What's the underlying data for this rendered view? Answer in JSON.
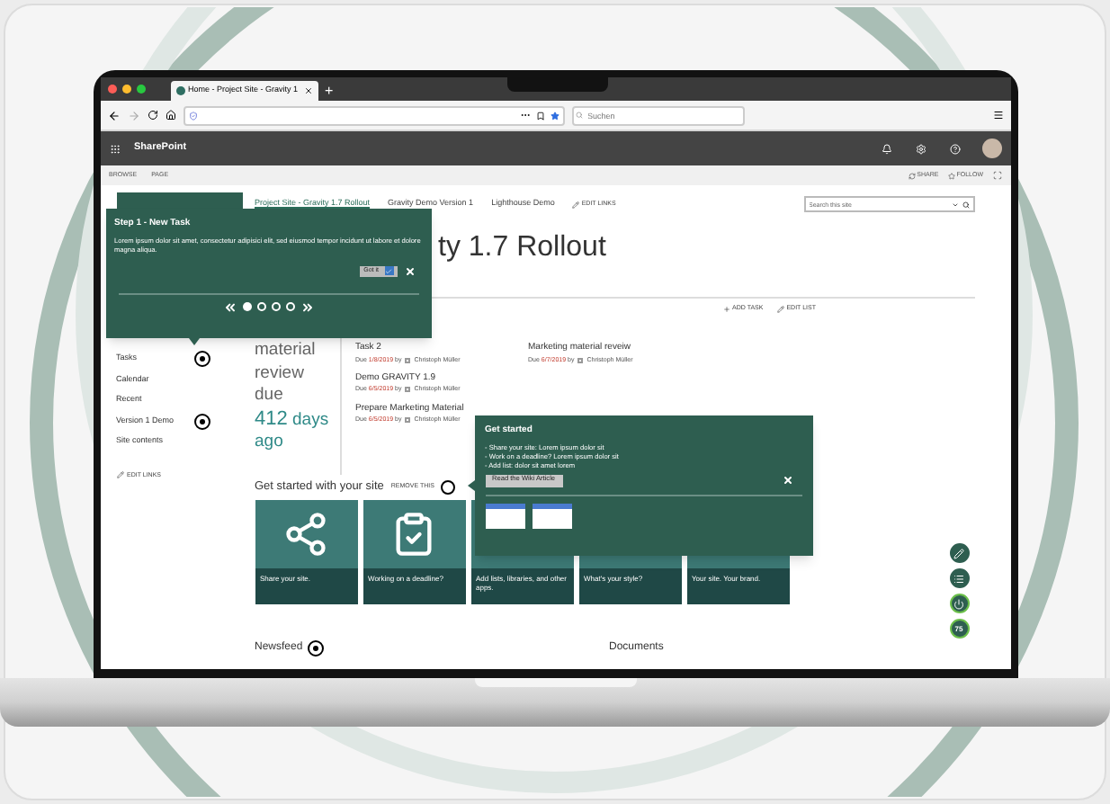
{
  "browser": {
    "tab_title": "Home - Project Site - Gravity 1",
    "new_tab": "+",
    "search_placeholder": "Suchen"
  },
  "suite_bar": {
    "app_name": "SharePoint"
  },
  "ribbon": {
    "tabs": [
      "BROWSE",
      "PAGE"
    ],
    "actions": [
      {
        "label": "SHARE",
        "kind": "share"
      },
      {
        "label": "FOLLOW",
        "kind": "follow"
      }
    ]
  },
  "top_nav": {
    "links": [
      {
        "label": "Project Site - Gravity 1.7 Rollout",
        "selected": true
      },
      {
        "label": "Gravity Demo Version 1",
        "selected": false
      },
      {
        "label": "Lighthouse Demo",
        "selected": false
      }
    ],
    "edit_links": "EDIT LINKS",
    "search_placeholder": "Search this site"
  },
  "page_title": "ty 1.7 Rollout",
  "list_actions": [
    {
      "label": "ADD TASK",
      "kind": "add"
    },
    {
      "label": "EDIT LIST",
      "kind": "edit"
    }
  ],
  "left_nav": {
    "items": [
      {
        "label": "Tasks",
        "marker": true
      },
      {
        "label": "Calendar",
        "marker": false
      },
      {
        "label": "Recent",
        "marker": false
      },
      {
        "label": "Version 1 Demo",
        "marker": true
      },
      {
        "label": "Site contents",
        "marker": false
      }
    ],
    "edit_links": "EDIT LINKS"
  },
  "countdown": {
    "lines": [
      "material",
      "review",
      "due"
    ],
    "number": "412",
    "unit": "days",
    "suffix": "ago"
  },
  "task_columns": [
    [
      {
        "title": "Task 2",
        "due": "Due",
        "date": "1/8/2019",
        "by": "by",
        "assignee": "Christoph Müller"
      },
      {
        "title": "Demo GRAVITY 1.9",
        "due": "Due",
        "date": "6/5/2019",
        "by": "by",
        "assignee": "Christoph Müller"
      },
      {
        "title": "Prepare Marketing Material",
        "due": "Due",
        "date": "6/5/2019",
        "by": "by",
        "assignee": "Christoph Müller"
      }
    ],
    [
      {
        "title": "Marketing material reveiw",
        "due": "Due",
        "date": "6/7/2019",
        "by": "by",
        "assignee": "Christoph Müller"
      }
    ]
  ],
  "get_started": {
    "heading": "Get started with your site",
    "remove": "REMOVE THIS",
    "tiles": [
      {
        "label": "Share your site.",
        "kind": "share"
      },
      {
        "label": "Working on a deadline?",
        "kind": "deadline"
      },
      {
        "label": "Add lists, libraries, and other apps.",
        "kind": "apps"
      },
      {
        "label": "What's your style?",
        "kind": "style"
      },
      {
        "label": "Your site. Your brand.",
        "kind": "brand"
      }
    ]
  },
  "sections": [
    {
      "label": "Newsfeed",
      "marker": true
    },
    {
      "label": "Documents",
      "marker": false
    }
  ],
  "floating_tools": [
    {
      "kind": "edit"
    },
    {
      "kind": "list"
    },
    {
      "kind": "power"
    },
    {
      "kind": "score",
      "label": "75"
    }
  ],
  "tour_step": {
    "title": "Step 1 - New Task",
    "body": "Lorem ipsum dolor sit amet, consectetur adipisici elit, sed eiusmod tempor incidunt ut labore et dolore magna aliqua.",
    "got_it": "Got it",
    "got_it_checked": true,
    "steps": [
      {
        "selected": true
      },
      {
        "selected": false
      },
      {
        "selected": false
      },
      {
        "selected": false
      }
    ]
  },
  "get_started_tip": {
    "title": "Get started",
    "lines": [
      "- Share your site: Lorem ipsum dolor sit",
      "- Work on a deadline? Lorem ipsum dolor sit",
      "- Add list: dolor sit amet lorem"
    ],
    "button": "Read the Wiki Article"
  }
}
